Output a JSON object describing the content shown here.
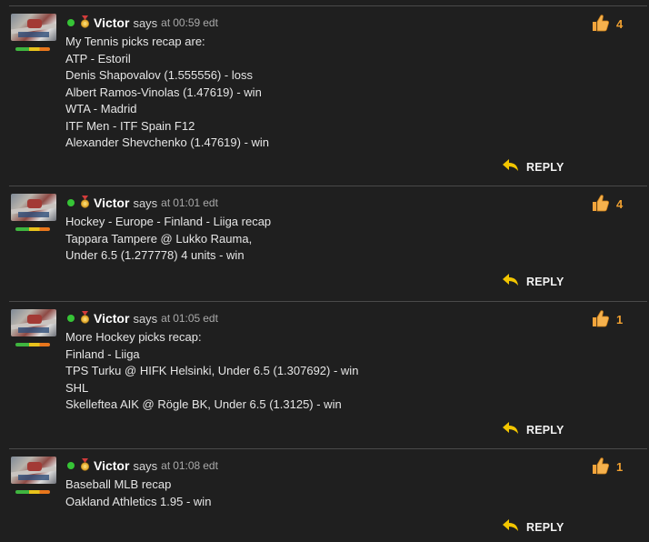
{
  "colors": {
    "background": "#1f1f1f",
    "divider": "#4a4a4a",
    "online": "#36c436",
    "likeCount": "#f0a030",
    "replyArrow": "#f2c500"
  },
  "icons": {
    "online": "green-dot-icon",
    "medal": "medal-icon",
    "like": "thumbs-up-icon",
    "reply": "reply-arrow-icon"
  },
  "comments": [
    {
      "author": "Victor",
      "says": "says",
      "at": "at",
      "time": "00:59",
      "tz": "edt",
      "likes": "4",
      "reply": "REPLY",
      "lines": [
        "My Tennis picks recap are:",
        "ATP - Estoril",
        "Denis Shapovalov (1.555556) - loss",
        "Albert Ramos-Vinolas (1.47619) - win",
        "WTA - Madrid",
        "ITF Men - ITF Spain F12",
        "Alexander Shevchenko (1.47619) - win"
      ]
    },
    {
      "author": "Victor",
      "says": "says",
      "at": "at",
      "time": "01:01",
      "tz": "edt",
      "likes": "4",
      "reply": "REPLY",
      "lines": [
        "Hockey - Europe - Finland - Liiga recap",
        "Tappara Tampere @ Lukko Rauma,",
        "Under 6.5 (1.277778) 4 units - win"
      ]
    },
    {
      "author": "Victor",
      "says": "says",
      "at": "at",
      "time": "01:05",
      "tz": "edt",
      "likes": "1",
      "reply": "REPLY",
      "lines": [
        "More Hockey picks recap:",
        "Finland - Liiga",
        "TPS Turku @ HIFK Helsinki, Under 6.5 (1.307692) - win",
        "SHL",
        "Skelleftea AIK @ Rögle BK, Under 6.5 (1.3125) - win"
      ]
    },
    {
      "author": "Victor",
      "says": "says",
      "at": "at",
      "time": "01:08",
      "tz": "edt",
      "likes": "1",
      "reply": "REPLY",
      "lines": [
        "Baseball MLB recap",
        "Oakland Athletics 1.95 - win"
      ]
    }
  ]
}
